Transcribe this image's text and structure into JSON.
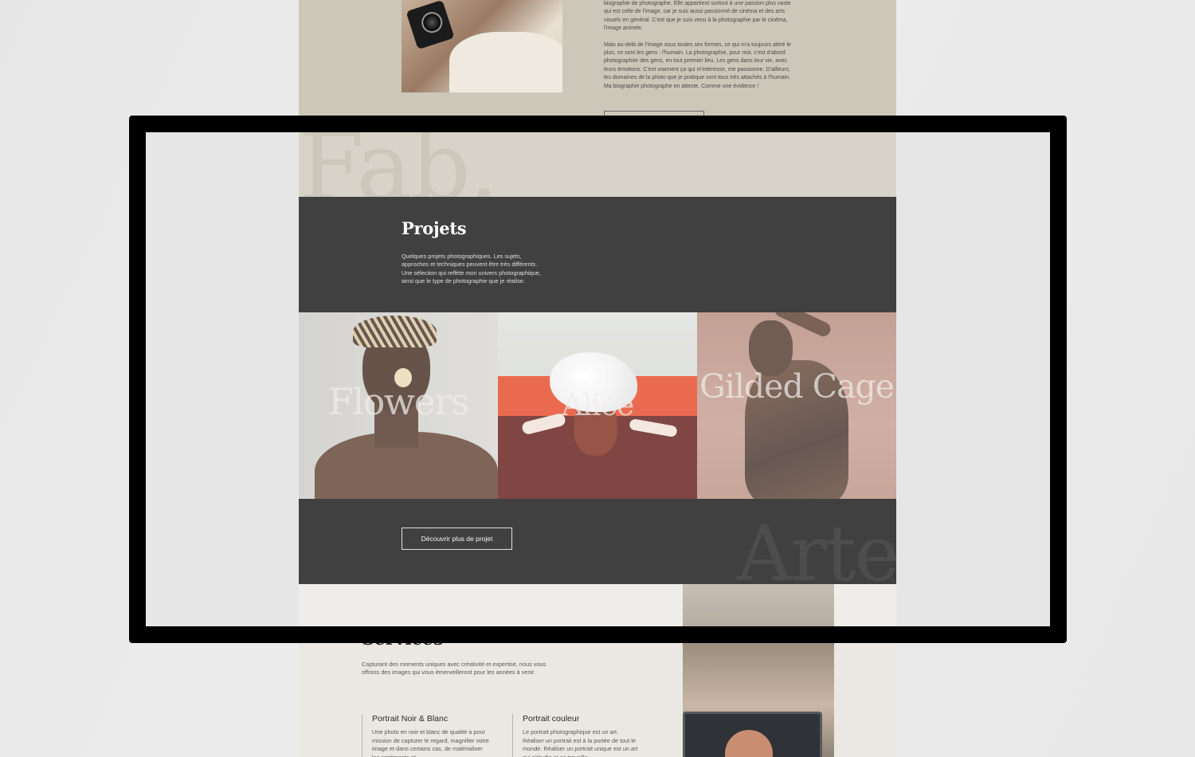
{
  "about": {
    "paragraph_1": "biographie de photographe. Elle appartient surtout à une passion plus vaste qui est celle de l'image, car je suis aussi passionné de cinéma et des arts visuels en général. C'est que je suis venu à la photographie par le cinéma, l'image animée.",
    "paragraph_2": "Mais au-delà de l'image sous toutes ses formes, ce qui m'a toujours attiré le plus, ce sont les gens : l'humain. La photographie, pour moi, c'est d'abord photographier des gens, en tout premier lieu. Les gens dans leur vie, avec leurs émotions. C'est vraiment ça qui m'intéresse, me passionne. D'ailleurs, les domaines de la photo que je pratique sont tous très attachés à l'humain. Ma biographie photographe en atteste. Comme une évidence !",
    "watermark": "Fab."
  },
  "projects": {
    "title": "Projets",
    "description": "Quelques projets photographiques. Les sujets, approches et techniques peuvent être très différents. Une sélection qui reflète mon univers photographique, ainsi que le type de photographie que je réalise.",
    "items": [
      {
        "title": "Flowers"
      },
      {
        "title": "Alice"
      },
      {
        "title": "Gilded Cage"
      }
    ],
    "cta_label": "Découvrir plus de projet",
    "watermark": "Arte"
  },
  "services": {
    "title": "Services",
    "description": "Capturant des moments uniques avec créativité et expertise, nous vous offrons des images qui vous émerveilleront pour les années à venir.",
    "cards": [
      {
        "title": "Portrait Noir & Blanc",
        "text": "Une photo en noir et blanc de qualité a pour mission de capturer le regard, magnifier votre image et dans certains cas, de matérialiser les sentiments et"
      },
      {
        "title": "Portrait couleur",
        "text": "Le portrait photographique est un art. Réaliser un portrait est à la portée de tout le monde. Réaliser un portrait unique est un art qui s'étudie et se travaille"
      }
    ]
  }
}
